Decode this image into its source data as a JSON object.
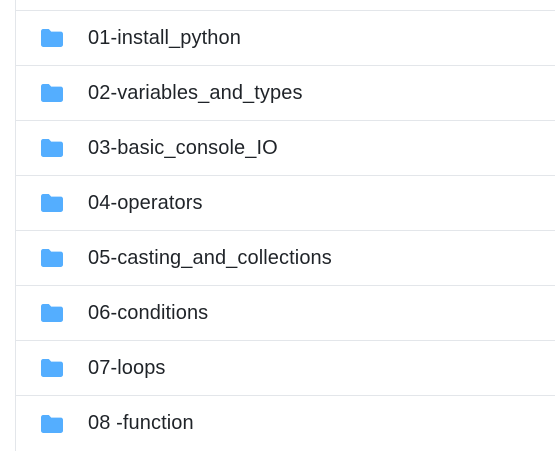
{
  "folder_list": {
    "items": [
      {
        "icon": "folder-icon",
        "name": "01-install_python"
      },
      {
        "icon": "folder-icon",
        "name": "02-variables_and_types"
      },
      {
        "icon": "folder-icon",
        "name": "03-basic_console_IO"
      },
      {
        "icon": "folder-icon",
        "name": "04-operators"
      },
      {
        "icon": "folder-icon",
        "name": "05-casting_and_collections"
      },
      {
        "icon": "folder-icon",
        "name": "06-conditions"
      },
      {
        "icon": "folder-icon",
        "name": "07-loops"
      },
      {
        "icon": "folder-icon",
        "name": "08 -function"
      }
    ]
  },
  "colors": {
    "folder_icon": "#54aeff",
    "text": "#1f2328",
    "divider": "#e3e6ea"
  }
}
